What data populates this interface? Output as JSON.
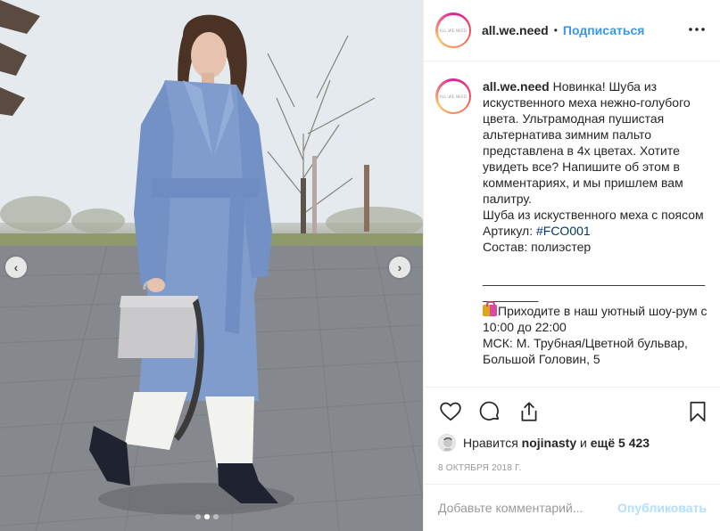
{
  "post": {
    "username": "all.we.need",
    "avatar_text": "ALL.WE.NEED",
    "bullet": "•",
    "follow_label": "Подписаться",
    "more_icon": "more-horizontal-icon",
    "carousel": {
      "slide_count": 3,
      "active_slide": 2,
      "prev_icon": "chevron-left-icon",
      "next_icon": "chevron-right-icon",
      "prev_glyph": "‹",
      "next_glyph": "›"
    }
  },
  "caption": {
    "username": "all.we.need",
    "lines": [
      "Новинка! Шуба из искуственного меха нежно-голубого цвета. Ультрамодная пушистая альтернатива зимним пальто представлена в 4х цветах. Хотите увидеть все? Напишите об этом в комментариях, и мы пришлем вам палитру.",
      "Шуба из искуственного меха с поясом"
    ],
    "article_label": "Артикул: ",
    "article_tag": "#FCO001",
    "composition": "Состав: полиэстер",
    "divider": "________________________________________",
    "showroom_text": "Приходите в наш уютный шоу-рум с 10:00 до 22:00",
    "address": "МСК: М. Трубная/Цветной бульвар, Большой Головин, 5"
  },
  "actions": {
    "like_icon": "heart-icon",
    "comment_icon": "comment-icon",
    "share_icon": "share-icon",
    "save_icon": "bookmark-icon"
  },
  "likes": {
    "prefix": "Нравится",
    "user": "nojinasty",
    "conj": "и",
    "others": "ещё 5 423"
  },
  "date": "8 октября 2018 г.",
  "comment": {
    "placeholder": "Добавьте комментарий...",
    "publish_label": "Опубликовать"
  },
  "colors": {
    "accent": "#3897f0",
    "publish_disabled": "#b2dffc",
    "hashtag": "#003569",
    "muted": "#999999",
    "coat": "#7f9ccc"
  }
}
